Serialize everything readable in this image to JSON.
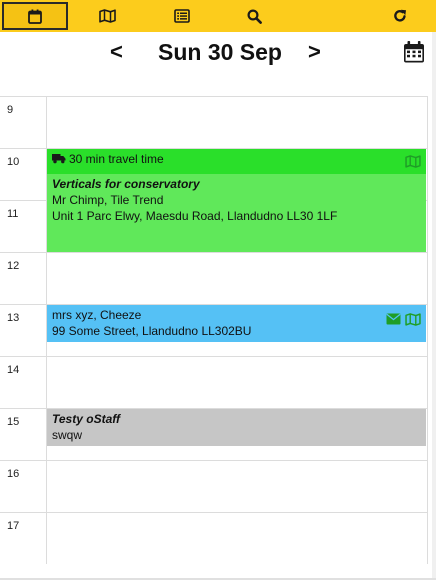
{
  "toolbar": {
    "background": "#fccc1c",
    "buttons": [
      {
        "icon": "calendar-icon",
        "active": true
      },
      {
        "icon": "map-icon",
        "active": false
      },
      {
        "icon": "list-icon",
        "active": false
      },
      {
        "icon": "search-icon",
        "active": false
      },
      {
        "icon": "refresh-icon",
        "active": false
      }
    ]
  },
  "header": {
    "prev_label": "<",
    "next_label": ">",
    "date": "Sun 30 Sep",
    "calendar_icon": "calendar-grid-icon"
  },
  "hours": [
    "9",
    "10",
    "11",
    "12",
    "13",
    "14",
    "15",
    "16",
    "17"
  ],
  "events": {
    "travel": {
      "text": "30 min travel time",
      "color": "#2adf2a"
    },
    "job1": {
      "title": "Verticals for conservatory",
      "line1": "Mr Chimp, Tile Trend",
      "line2": "Unit 1 Parc Elwy, Maesdu Road, Llandudno LL30 1LF",
      "color": "#60e85a"
    },
    "job2": {
      "line1": "mrs xyz, Cheeze",
      "line2": "99 Some Street, Llandudno LL302BU",
      "color": "#55c1f5"
    },
    "job3": {
      "title": "Testy oStaff",
      "line1": "swqw",
      "color": "#c6c6c6"
    }
  }
}
